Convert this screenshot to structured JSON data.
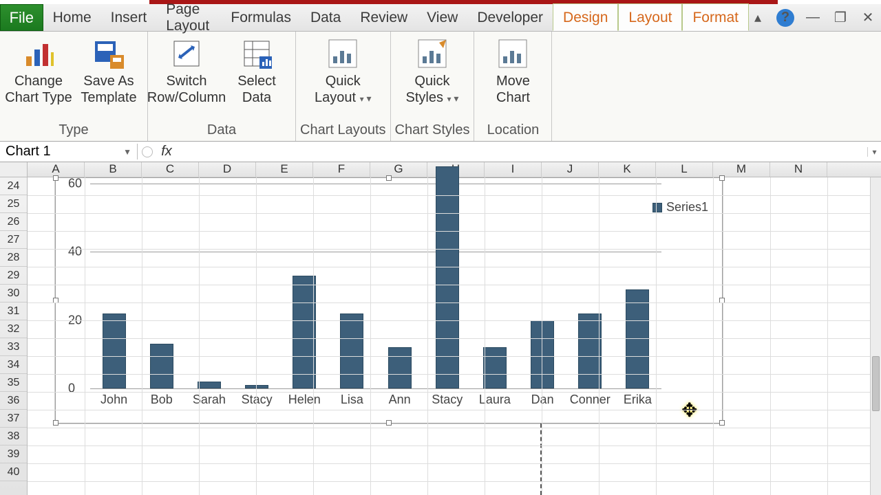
{
  "tabs": {
    "file": "File",
    "items": [
      "Home",
      "Insert",
      "Page Layout",
      "Formulas",
      "Data",
      "Review",
      "View",
      "Developer"
    ],
    "context": [
      "Design",
      "Layout",
      "Format"
    ],
    "active_context": "Design"
  },
  "ribbon": {
    "groups": [
      {
        "name": "Type",
        "buttons": [
          {
            "id": "change-chart-type",
            "label": "Change\nChart Type"
          },
          {
            "id": "save-as-template",
            "label": "Save As\nTemplate"
          }
        ]
      },
      {
        "name": "Data",
        "buttons": [
          {
            "id": "switch-row-column",
            "label": "Switch\nRow/Column"
          },
          {
            "id": "select-data",
            "label": "Select\nData"
          }
        ]
      },
      {
        "name": "Chart Layouts",
        "buttons": [
          {
            "id": "quick-layout",
            "label": "Quick\nLayout",
            "dropdown": true
          }
        ]
      },
      {
        "name": "Chart Styles",
        "buttons": [
          {
            "id": "quick-styles",
            "label": "Quick\nStyles",
            "dropdown": true
          }
        ]
      },
      {
        "name": "Location",
        "buttons": [
          {
            "id": "move-chart",
            "label": "Move\nChart"
          }
        ]
      }
    ]
  },
  "formula_bar": {
    "name_box": "Chart 1",
    "formula": ""
  },
  "columns": [
    "A",
    "B",
    "C",
    "D",
    "E",
    "F",
    "G",
    "H",
    "I",
    "J",
    "K",
    "L",
    "M",
    "N"
  ],
  "rows_visible_start": 24,
  "rows_visible_end": 40,
  "legend_label": "Series1",
  "chart_data": {
    "type": "bar",
    "categories": [
      "John",
      "Bob",
      "Sarah",
      "Stacy",
      "Helen",
      "Lisa",
      "Ann",
      "Stacy",
      "Laura",
      "Dan",
      "Conner",
      "Erika"
    ],
    "values": [
      22,
      13,
      2,
      1,
      33,
      22,
      12,
      65,
      12,
      20,
      22,
      29
    ],
    "series_name": "Series1",
    "title": "",
    "xlabel": "",
    "ylabel": "",
    "ylim": [
      0,
      60
    ],
    "yticks": [
      0,
      20,
      40,
      60
    ],
    "grid": true,
    "legend_position": "right"
  }
}
